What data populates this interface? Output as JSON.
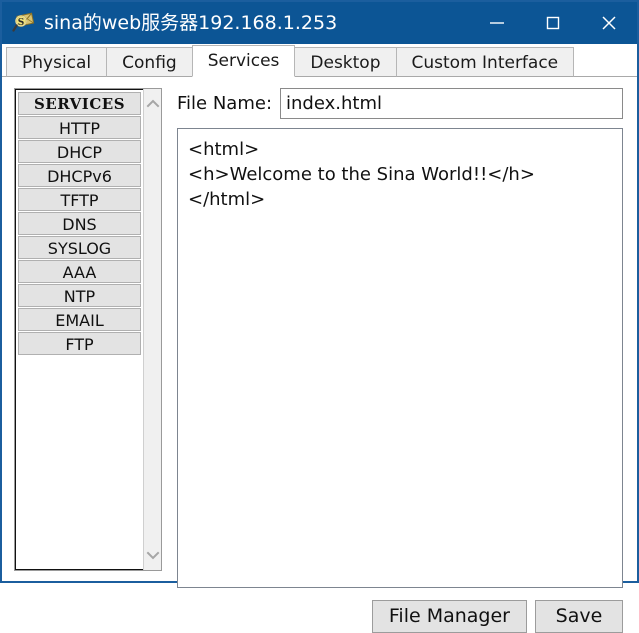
{
  "window": {
    "title": "sina的web服务器192.168.1.253",
    "icon": "packet-tracer-server-icon",
    "controls": {
      "minimize": "minimize-icon",
      "maximize": "maximize-icon",
      "close": "close-icon"
    },
    "accent_color": "#0c5595",
    "border_color": "#1b5e9e"
  },
  "tabs": [
    {
      "label": "Physical",
      "active": false
    },
    {
      "label": "Config",
      "active": false
    },
    {
      "label": "Services",
      "active": true
    },
    {
      "label": "Desktop",
      "active": false
    },
    {
      "label": "Custom Interface",
      "active": false
    }
  ],
  "sidebar": {
    "header": "SERVICES",
    "items": [
      {
        "label": "HTTP"
      },
      {
        "label": "DHCP"
      },
      {
        "label": "DHCPv6"
      },
      {
        "label": "TFTP"
      },
      {
        "label": "DNS"
      },
      {
        "label": "SYSLOG"
      },
      {
        "label": "AAA"
      },
      {
        "label": "NTP"
      },
      {
        "label": "EMAIL"
      },
      {
        "label": "FTP"
      }
    ],
    "scrollbar": {
      "up_arrow": "chevron-up-icon",
      "down_arrow": "chevron-down-icon"
    }
  },
  "main": {
    "file_name_label": "File Name:",
    "file_name_value": "index.html",
    "file_name_placeholder": "",
    "editor_content": "<html>\n<h>Welcome to the Sina World!!</h>\n</html>"
  },
  "buttons": {
    "file_manager": "File Manager",
    "save": "Save"
  }
}
